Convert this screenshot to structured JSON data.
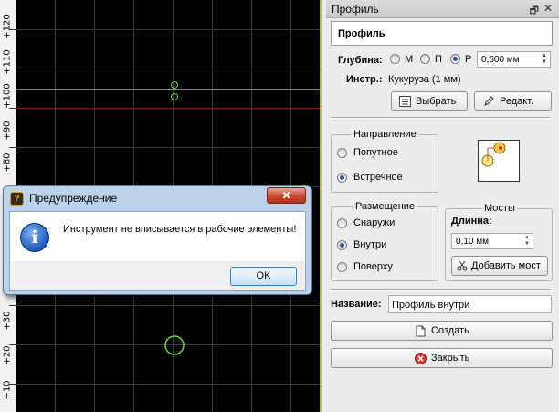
{
  "canvas": {
    "ruler_labels": [
      "+120",
      "+110",
      "+100",
      "+90",
      "+80",
      "+30",
      "+20",
      "+10"
    ]
  },
  "dialog": {
    "title": "Предупреждение",
    "close_label": "✕",
    "message": "Инструмент не вписывается в рабочие элементы!",
    "ok_label": "OK",
    "icon": "info-icon"
  },
  "panel": {
    "title": "Профиль",
    "restore_glyph": "🗗",
    "close_glyph": "✕",
    "profile_name": "Профиль",
    "depth": {
      "label": "Глубина:",
      "options": [
        "М",
        "П",
        "Р"
      ],
      "selected": "Р",
      "value": "0,600 мм"
    },
    "tool": {
      "label": "Инстр.:",
      "value": "Кукуруза (1 мм)"
    },
    "buttons": {
      "select": "Выбрать",
      "edit": "Редакт."
    },
    "direction": {
      "title": "Направление",
      "options": [
        "Попутное",
        "Встречное"
      ],
      "selected": "Встречное"
    },
    "placement": {
      "title": "Размещение",
      "options": [
        "Снаружи",
        "Внутри",
        "Поверху"
      ],
      "selected": "Внутри"
    },
    "bridges": {
      "title": "Мосты",
      "length_label": "Длинна:",
      "length_value": "0,10 мм",
      "add_label": "Добавить мост"
    },
    "name": {
      "label": "Название:",
      "value": "Профиль внутри"
    },
    "create_label": "Создать",
    "close_label": "Закрыть"
  },
  "colors": {
    "canvas_bg": "#000000",
    "grid": "#3a3a3a",
    "axis_red": "#7a1a1a",
    "axis_yellow": "#8c8c20",
    "shape_green": "#5fdc3c",
    "dialog_frame": "#bcd2ea",
    "panel_bg": "#ececec"
  }
}
